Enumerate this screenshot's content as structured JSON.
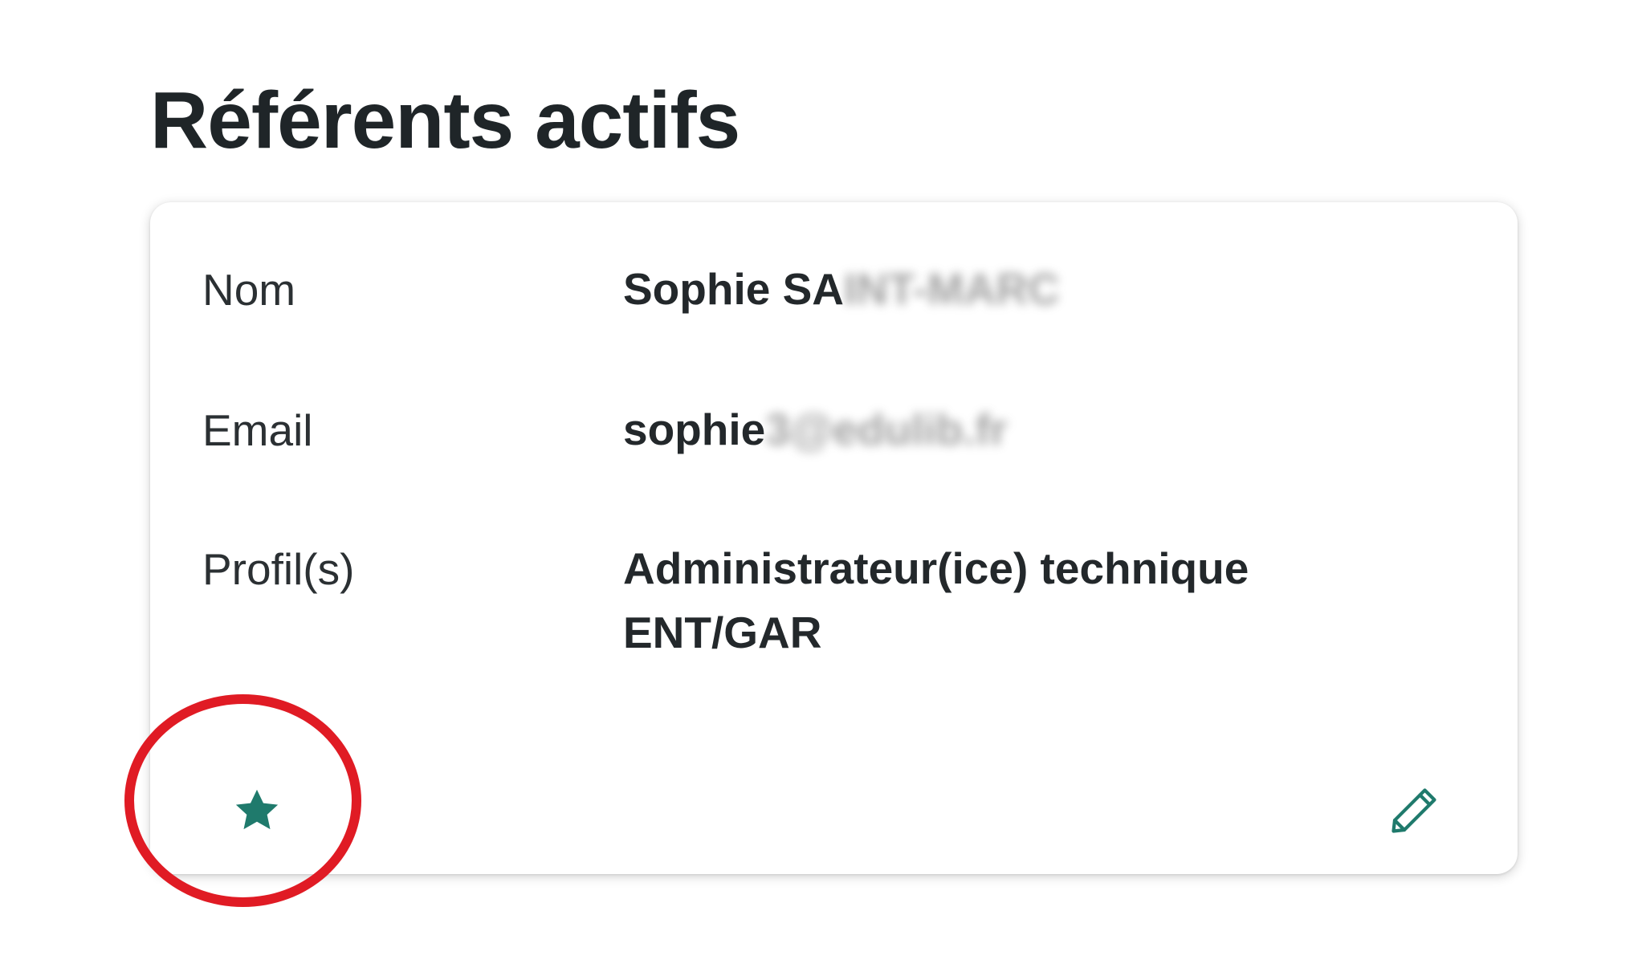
{
  "section": {
    "title": "Référents actifs"
  },
  "referent": {
    "fields": [
      {
        "label": "Nom",
        "value_visible": "Sophie SA",
        "value_obscured": "INT-MARC"
      },
      {
        "label": "Email",
        "value_visible": "sophie",
        "value_obscured": "3@edulib.fr"
      },
      {
        "label": "Profil(s)",
        "value_line1": "Administrateur(ice) technique",
        "value_line2": "ENT/GAR"
      }
    ],
    "primary_icon": "star-icon",
    "edit_icon": "pencil-icon"
  },
  "colors": {
    "accent": "#1f7a6c",
    "highlight": "#e01b24"
  }
}
